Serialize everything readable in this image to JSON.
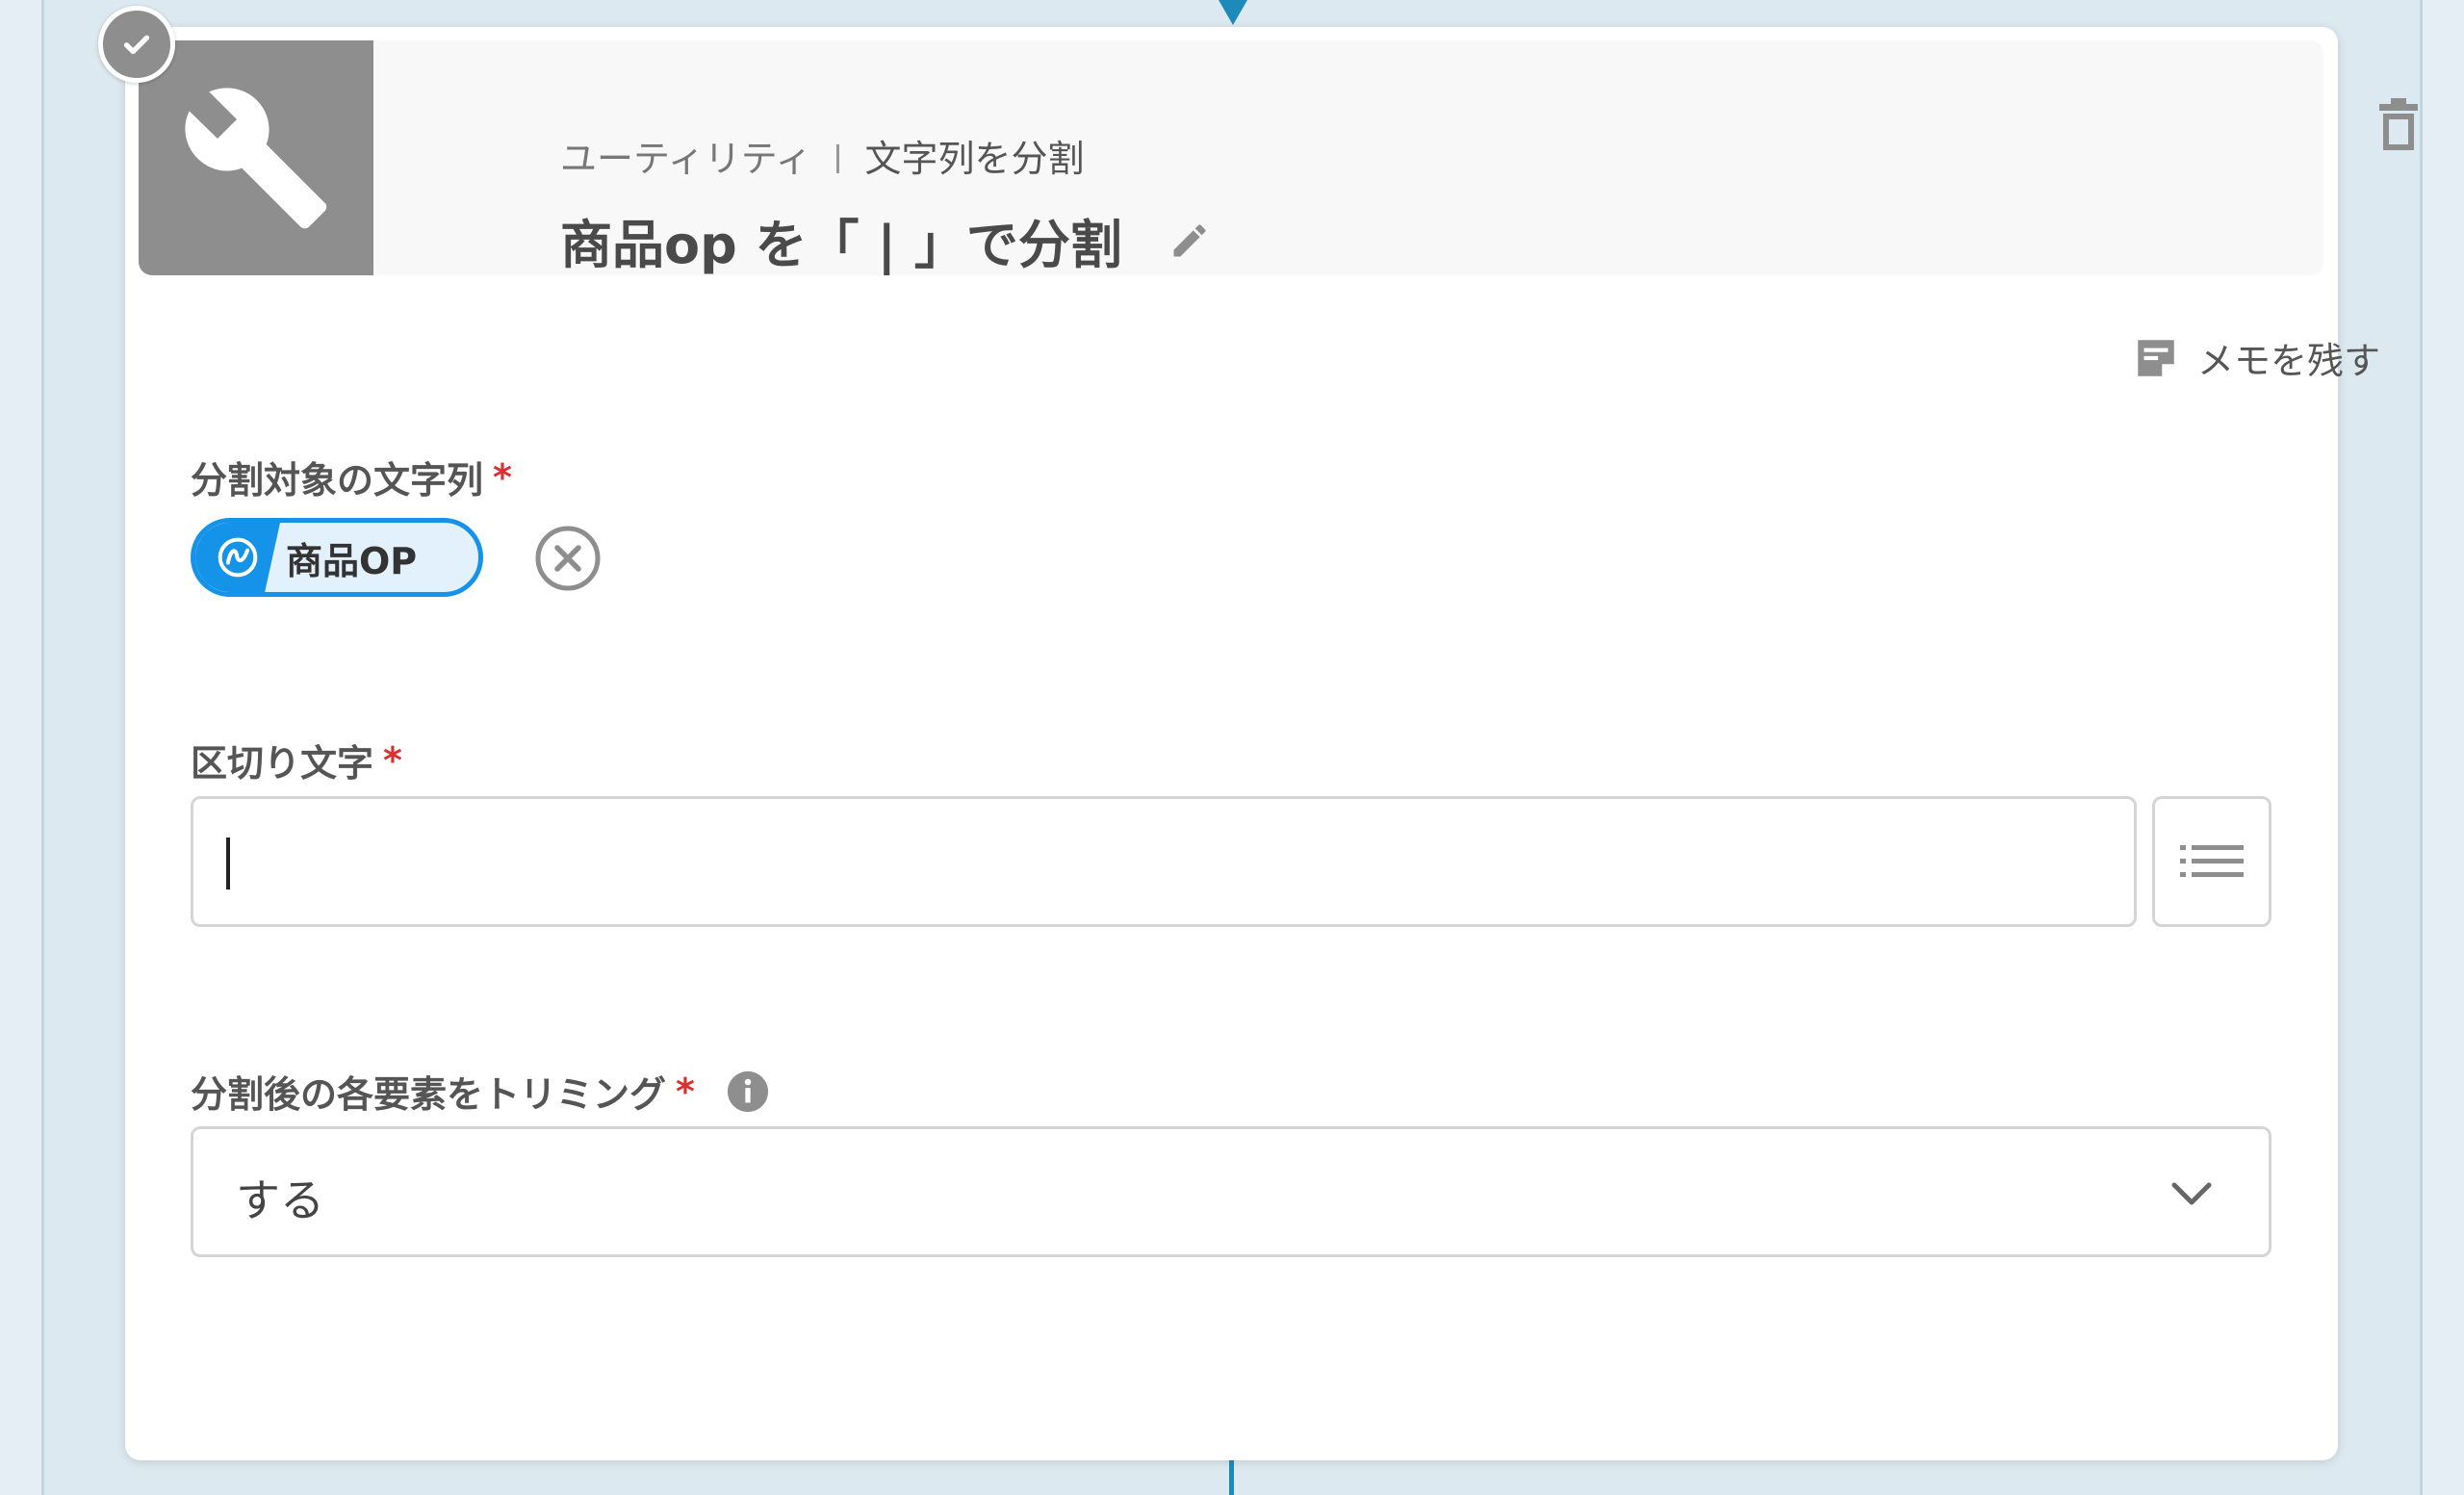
{
  "header": {
    "category": "ユーティリティ",
    "action": "文字列を分割",
    "title": "商品op を「 | 」で分割",
    "icon": "tools-icon",
    "status_icon": "check-icon"
  },
  "memo": {
    "label": "メモを残す",
    "icon": "memo-icon"
  },
  "fields": {
    "target": {
      "label": "分割対象の文字列",
      "required_mark": "*",
      "variable": "商品OP",
      "variable_icon": "variable-icon"
    },
    "delimiter": {
      "label": "区切り文字",
      "required_mark": "*",
      "value": "",
      "list_icon": "list-icon"
    },
    "trim": {
      "label": "分割後の各要素をトリミング",
      "required_mark": "*",
      "selected": "する",
      "info_icon": "info-icon"
    }
  },
  "colors": {
    "accent": "#1493e8",
    "connector": "#1d8ab8",
    "required": "#d93030",
    "icon_gray": "#8e8e8e"
  }
}
